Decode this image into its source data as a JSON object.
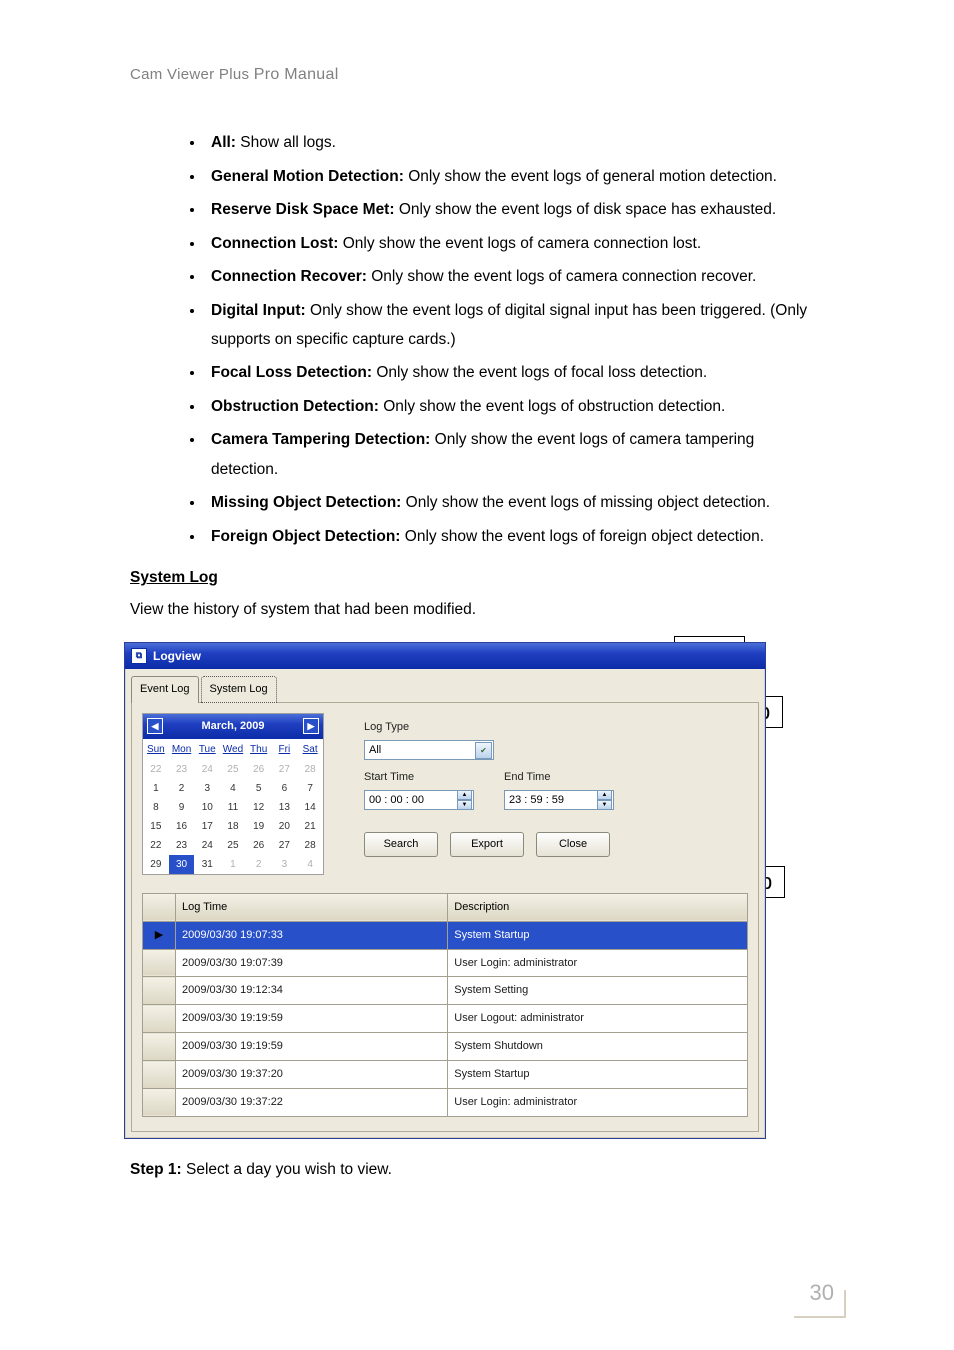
{
  "doc_header": {
    "prefix": "Cam Viewer Plus ",
    "suffix": "Pro Manual"
  },
  "bullets": [
    {
      "term": "All:",
      "text": " Show all logs."
    },
    {
      "term": "General Motion Detection:",
      "text": " Only show the event logs of general motion detection."
    },
    {
      "term": "Reserve Disk Space Met:",
      "text": " Only show the event logs of disk space has exhausted."
    },
    {
      "term": "Connection Lost:",
      "text": " Only show the event logs of camera connection lost."
    },
    {
      "term": "Connection Recover:",
      "text": " Only show the event logs of camera connection recover."
    },
    {
      "term": "Digital Input:",
      "text": " Only show the event logs of digital signal input has been triggered. (Only supports on specific capture cards.)"
    },
    {
      "term": "Focal Loss Detection:",
      "text": " Only show the event logs of focal loss detection."
    },
    {
      "term": "Obstruction Detection:",
      "text": " Only show the event logs of obstruction detection."
    },
    {
      "term": "Camera Tampering Detection:",
      "text": " Only show the event logs of camera tampering detection."
    },
    {
      "term": "Missing Object Detection:",
      "text": " Only show the event logs of missing object detection."
    },
    {
      "term": "Foreign Object Detection:",
      "text": " Only show the event logs of foreign object detection."
    }
  ],
  "section_heading": "System Log",
  "section_text": "View the history of system that had been modified.",
  "window": {
    "title": "Logview",
    "tabs": {
      "event": "Event Log",
      "system": "System Log"
    },
    "calendar": {
      "title": "March, 2009",
      "dow": [
        "Sun",
        "Mon",
        "Tue",
        "Wed",
        "Thu",
        "Fri",
        "Sat"
      ],
      "rows": [
        [
          {
            "d": "22",
            "g": true
          },
          {
            "d": "23",
            "g": true
          },
          {
            "d": "24",
            "g": true
          },
          {
            "d": "25",
            "g": true
          },
          {
            "d": "26",
            "g": true
          },
          {
            "d": "27",
            "g": true
          },
          {
            "d": "28",
            "g": true
          }
        ],
        [
          {
            "d": "1"
          },
          {
            "d": "2"
          },
          {
            "d": "3"
          },
          {
            "d": "4"
          },
          {
            "d": "5"
          },
          {
            "d": "6"
          },
          {
            "d": "7"
          }
        ],
        [
          {
            "d": "8"
          },
          {
            "d": "9"
          },
          {
            "d": "10"
          },
          {
            "d": "11"
          },
          {
            "d": "12"
          },
          {
            "d": "13"
          },
          {
            "d": "14"
          }
        ],
        [
          {
            "d": "15"
          },
          {
            "d": "16"
          },
          {
            "d": "17"
          },
          {
            "d": "18"
          },
          {
            "d": "19"
          },
          {
            "d": "20"
          },
          {
            "d": "21"
          }
        ],
        [
          {
            "d": "22"
          },
          {
            "d": "23"
          },
          {
            "d": "24"
          },
          {
            "d": "25"
          },
          {
            "d": "26"
          },
          {
            "d": "27"
          },
          {
            "d": "28"
          }
        ],
        [
          {
            "d": "29"
          },
          {
            "d": "30",
            "sel": true
          },
          {
            "d": "31"
          },
          {
            "d": "1",
            "g": true
          },
          {
            "d": "2",
            "g": true
          },
          {
            "d": "3",
            "g": true
          },
          {
            "d": "4",
            "g": true
          }
        ]
      ]
    },
    "controls": {
      "log_type_label": "Log Type",
      "log_type_value": "All",
      "start_time_label": "Start Time",
      "start_time_value": "00 : 00 : 00",
      "end_time_label": "End Time",
      "end_time_value": "23 : 59 : 59",
      "search": "Search",
      "export": "Export",
      "close": "Close"
    },
    "table": {
      "headers": {
        "time": "Log Time",
        "desc": "Description"
      },
      "rows": [
        {
          "time": "2009/03/30   19:07:33",
          "desc": "System Startup",
          "sel": true
        },
        {
          "time": "2009/03/30   19:07:39",
          "desc": "User Login: administrator"
        },
        {
          "time": "2009/03/30   19:12:34",
          "desc": "System Setting"
        },
        {
          "time": "2009/03/30   19:19:59",
          "desc": "User Logout: administrator"
        },
        {
          "time": "2009/03/30   19:19:59",
          "desc": "System Shutdown"
        },
        {
          "time": "2009/03/30   19:37:20",
          "desc": "System Startup"
        },
        {
          "time": "2009/03/30   19:37:22",
          "desc": "User Login: administrator"
        }
      ]
    }
  },
  "callouts": {
    "step": "Step"
  },
  "step1_label": "Step 1:",
  "step1_text": " Select a day you wish to view.",
  "page_number": "30"
}
